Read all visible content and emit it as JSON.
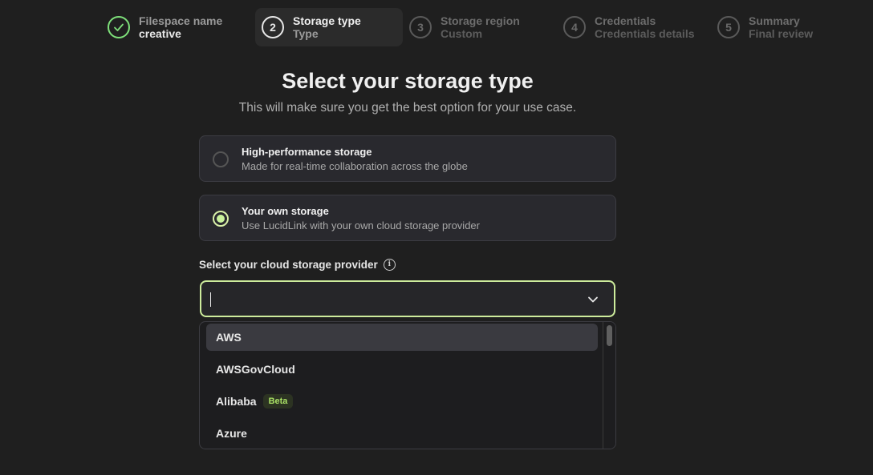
{
  "stepper": [
    {
      "state": "done",
      "number": "",
      "title": "Filespace name",
      "subtitle": "creative"
    },
    {
      "state": "active",
      "number": "2",
      "title": "Storage type",
      "subtitle": "Type"
    },
    {
      "state": "pending",
      "number": "3",
      "title": "Storage region",
      "subtitle": "Custom"
    },
    {
      "state": "pending",
      "number": "4",
      "title": "Credentials",
      "subtitle": "Credentials details"
    },
    {
      "state": "pending",
      "number": "5",
      "title": "Summary",
      "subtitle": "Final review"
    }
  ],
  "heading": {
    "title": "Select your storage type",
    "subtitle": "This will make sure you get the best option for your use case."
  },
  "options": [
    {
      "title": "High-performance storage",
      "description": "Made for real-time collaboration across the globe",
      "selected": false
    },
    {
      "title": "Your own storage",
      "description": "Use LucidLink with your own cloud storage provider",
      "selected": true
    }
  ],
  "provider_select": {
    "label": "Select your cloud storage provider",
    "value": "",
    "items": [
      {
        "label": "AWS",
        "badge": "",
        "highlighted": true
      },
      {
        "label": "AWSGovCloud",
        "badge": "",
        "highlighted": false
      },
      {
        "label": "Alibaba",
        "badge": "Beta",
        "highlighted": false
      },
      {
        "label": "Azure",
        "badge": "",
        "highlighted": false
      }
    ]
  },
  "colors": {
    "accent": "#cdec9c",
    "done_green": "#7ee07a",
    "badge_text": "#a9e065"
  },
  "icons": {
    "done_step": "checkmark-icon",
    "info": "info-icon",
    "dropdown": "chevron-down-icon"
  }
}
